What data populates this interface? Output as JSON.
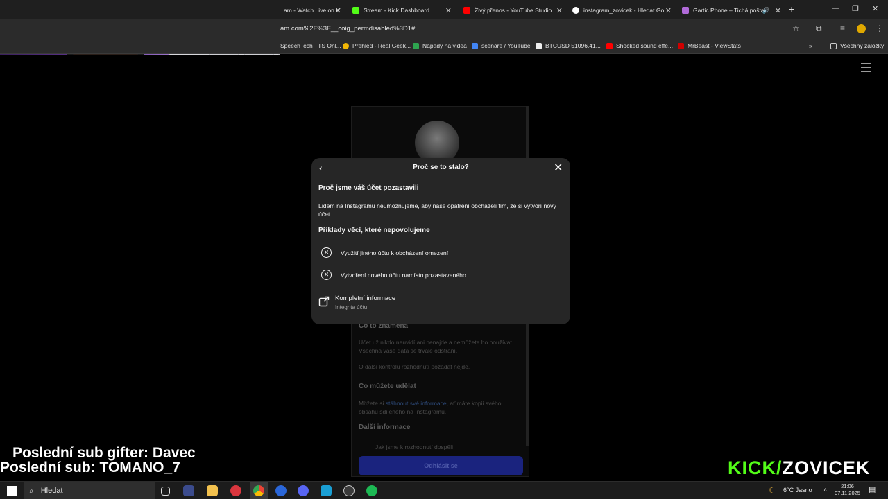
{
  "browser": {
    "tabs": [
      {
        "label": "am - Watch Live on K",
        "icon_color": "#2b2b2b"
      },
      {
        "label": "Stream - Kick Dashboard",
        "icon_color": "#53fc18"
      },
      {
        "label": "Živý přenos - YouTube Studio",
        "icon_color": "#ff0000"
      },
      {
        "label": "instagram_zovicek - Hledat Go",
        "icon_color": "#ffffff"
      },
      {
        "label": "Gartic Phone – Tichá pošta",
        "icon_color": "#b06ad8"
      }
    ],
    "url": "am.com%2F%3F__coig_permdisabled%3D1#",
    "bookmarks": [
      {
        "label": "SpeechTech TTS Onl...",
        "icon_color": "#1f1f1f"
      },
      {
        "label": "Přehled - Real Geek...",
        "icon_color": "#f2b705"
      },
      {
        "label": "Nápady na videa",
        "icon_color": "#2ea44f"
      },
      {
        "label": "scénáře / YouTube",
        "icon_color": "#4285f4"
      },
      {
        "label": "BTCUSD 51096.41...",
        "icon_color": "#111111"
      },
      {
        "label": "Shocked sound effe...",
        "icon_color": "#ff0000"
      },
      {
        "label": "MrBeast - ViewStats",
        "icon_color": "#d00000"
      }
    ],
    "all_bookmarks": "Všechny záložky"
  },
  "background": {
    "section1": "Co to znamená",
    "text1": "Účet už nikdo neuvidí ani nenajde a nemůžete ho používat. Všechna vaše data se trvale odstraní.",
    "text2": "O další kontrolu rozhodnutí požádat nejde.",
    "section2": "Co můžete udělat",
    "text3_pre": "Můžete si ",
    "text3_link": "stáhnout své informace",
    "text3_post": ", ať máte kopii svého obsahu sdíleného na Instagramu.",
    "section3": "Další informace",
    "text4": "Jak jsme k rozhodnutí dospěli",
    "logout": "Odhlásit se"
  },
  "modal": {
    "title": "Proč se to stalo?",
    "heading": "Proč jsme váš účet pozastavili",
    "paragraph": "Lidem na Instagramu neumožňujeme, aby naše opatření obcházeli tím, že si vytvoří nový účet.",
    "examples_heading": "Příklady věcí, které nepovolujeme",
    "examples": [
      "Využití jiného účtu k obcházení omezení",
      "Vytvoření nového účtu namísto pozastaveného"
    ],
    "link_title": "Kompletní informace",
    "link_subtitle": "Integrita účtu"
  },
  "overlay": {
    "last_gifter": "Poslední sub gifter: Davec",
    "last_sub": "Poslední sub: TOMANO_7",
    "logo_kick": "KICK/",
    "logo_name": "ZOVICEK"
  },
  "taskbar": {
    "search_placeholder": "Hledat",
    "weather": "6°C  Jasno",
    "time": "21:06",
    "date": "07.11.2025"
  }
}
